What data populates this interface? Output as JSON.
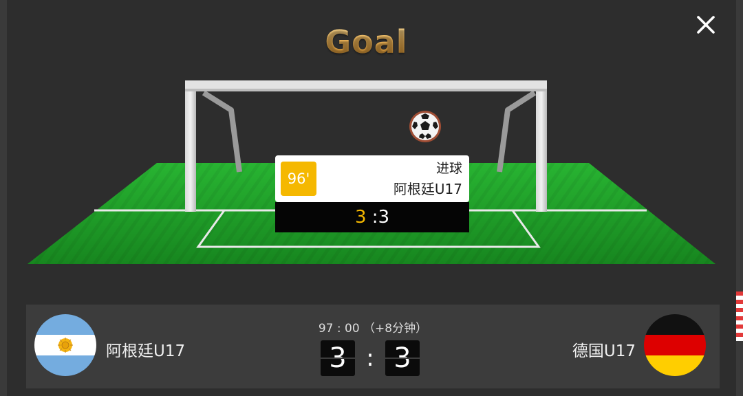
{
  "modal": {
    "title": "Goal",
    "close_icon": "close-icon"
  },
  "event": {
    "minute": "96'",
    "type": "进球",
    "team": "阿根廷U17",
    "score_home": "3",
    "score_sep": " :",
    "score_away": "3",
    "minute_color": "#f5b800"
  },
  "match": {
    "time": "97 : 00 （+8分钟）",
    "home_team": "阿根廷U17",
    "away_team": "德国U17",
    "home_score": "3",
    "score_separator": ":",
    "away_score": "3",
    "home_flag": "argentina-flag",
    "away_flag": "germany-flag"
  },
  "colors": {
    "accent": "#f5b800",
    "pitch": "#1f9a2a",
    "panel": "#3c3c3c",
    "background": "#2d2d2d"
  }
}
